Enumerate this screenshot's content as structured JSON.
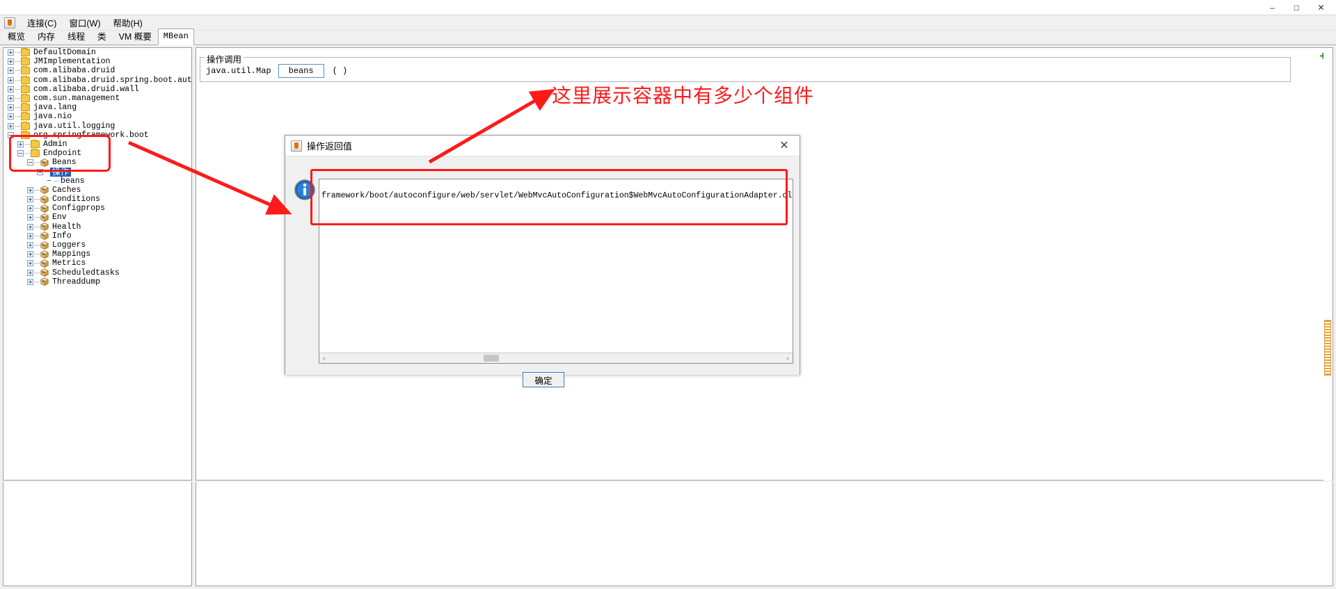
{
  "window": {
    "title": "",
    "controls": {
      "minimize": "–",
      "maximize": "□",
      "close": "✕"
    }
  },
  "menubar": {
    "app_icon": "java-icon",
    "items": [
      {
        "label": "连接(C)",
        "mnemonic": "C"
      },
      {
        "label": "窗口(W)",
        "mnemonic": "W"
      },
      {
        "label": "帮助(H)",
        "mnemonic": "H"
      }
    ]
  },
  "tabs": [
    {
      "label": "概览",
      "active": false
    },
    {
      "label": "内存",
      "active": false
    },
    {
      "label": "线程",
      "active": false
    },
    {
      "label": "类",
      "active": false
    },
    {
      "label": "VM 概要",
      "active": false
    },
    {
      "label": "MBean",
      "active": true
    }
  ],
  "tree": {
    "nodes": [
      {
        "label": "DefaultDomain",
        "indent": 0,
        "toggle": "plus",
        "icon": "folder"
      },
      {
        "label": "JMImplementation",
        "indent": 0,
        "toggle": "plus",
        "icon": "folder"
      },
      {
        "label": "com.alibaba.druid",
        "indent": 0,
        "toggle": "plus",
        "icon": "folder"
      },
      {
        "label": "com.alibaba.druid.spring.boot.autoconfigure",
        "indent": 0,
        "toggle": "plus",
        "icon": "folder"
      },
      {
        "label": "com.alibaba.druid.wall",
        "indent": 0,
        "toggle": "plus",
        "icon": "folder"
      },
      {
        "label": "com.sun.management",
        "indent": 0,
        "toggle": "plus",
        "icon": "folder"
      },
      {
        "label": "java.lang",
        "indent": 0,
        "toggle": "plus",
        "icon": "folder"
      },
      {
        "label": "java.nio",
        "indent": 0,
        "toggle": "plus",
        "icon": "folder"
      },
      {
        "label": "java.util.logging",
        "indent": 0,
        "toggle": "plus",
        "icon": "folder"
      },
      {
        "label": "org.springframework.boot",
        "indent": 0,
        "toggle": "minus",
        "icon": "folder"
      },
      {
        "label": "Admin",
        "indent": 1,
        "toggle": "plus",
        "icon": "folder"
      },
      {
        "label": "Endpoint",
        "indent": 1,
        "toggle": "minus",
        "icon": "folder"
      },
      {
        "label": "Beans",
        "indent": 2,
        "toggle": "minus",
        "icon": "bean"
      },
      {
        "label": "操作",
        "indent": 3,
        "toggle": "minus",
        "icon": "none",
        "selected": true
      },
      {
        "label": "beans",
        "indent": 4,
        "toggle": "none",
        "icon": "none"
      },
      {
        "label": "Caches",
        "indent": 2,
        "toggle": "plus",
        "icon": "bean"
      },
      {
        "label": "Conditions",
        "indent": 2,
        "toggle": "plus",
        "icon": "bean"
      },
      {
        "label": "Configprops",
        "indent": 2,
        "toggle": "plus",
        "icon": "bean"
      },
      {
        "label": "Env",
        "indent": 2,
        "toggle": "plus",
        "icon": "bean"
      },
      {
        "label": "Health",
        "indent": 2,
        "toggle": "plus",
        "icon": "bean"
      },
      {
        "label": "Info",
        "indent": 2,
        "toggle": "plus",
        "icon": "bean"
      },
      {
        "label": "Loggers",
        "indent": 2,
        "toggle": "plus",
        "icon": "bean"
      },
      {
        "label": "Mappings",
        "indent": 2,
        "toggle": "plus",
        "icon": "bean"
      },
      {
        "label": "Metrics",
        "indent": 2,
        "toggle": "plus",
        "icon": "bean"
      },
      {
        "label": "Scheduledtasks",
        "indent": 2,
        "toggle": "plus",
        "icon": "bean"
      },
      {
        "label": "Threaddump",
        "indent": 2,
        "toggle": "plus",
        "icon": "bean"
      }
    ]
  },
  "content": {
    "group_title": "操作调用",
    "operation": {
      "return_type": "java.util.Map",
      "method_name": "beans",
      "parens": "( )"
    },
    "add_icon": "+"
  },
  "dialog": {
    "title": "操作返回值",
    "close_label": "✕",
    "icon": "info-icon",
    "return_value": "framework/boot/autoconfigure/web/servlet/WebMvcAutoConfiguration$WebMvcAutoConfigurationAdapter.class], dependencies=[]}",
    "scroll_left": "‹",
    "scroll_right": "›",
    "ok_label": "确定"
  },
  "annotations": {
    "text": "这里展示容器中有多少个组件",
    "color": "#ff1a1a"
  }
}
